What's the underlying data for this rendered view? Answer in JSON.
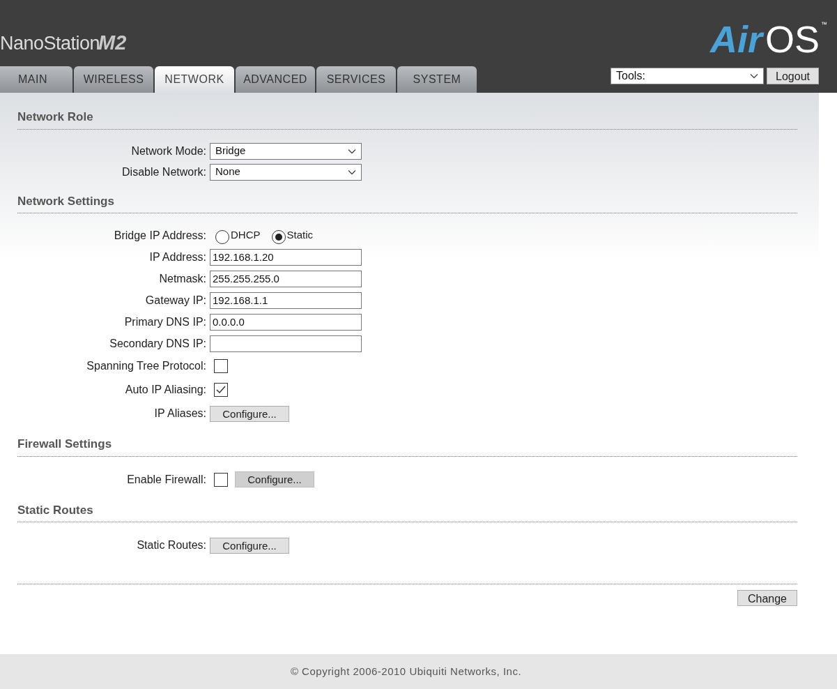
{
  "header": {
    "product": "NanoStation",
    "model": "M2",
    "logo": {
      "part_1": "Air",
      "part_2": "OS",
      "trademark": "™"
    }
  },
  "tabs": [
    {
      "label": "MAIN",
      "selected": false
    },
    {
      "label": "WIRELESS",
      "selected": false
    },
    {
      "label": "NETWORK",
      "selected": true
    },
    {
      "label": "ADVANCED",
      "selected": false
    },
    {
      "label": "SERVICES",
      "selected": false
    },
    {
      "label": "SYSTEM",
      "selected": false
    }
  ],
  "tools": {
    "value": "Tools:"
  },
  "logout_button": "Logout",
  "sections": [
    {
      "title": "Network Role",
      "rows": [
        {
          "kind": "select",
          "label": "Network Mode:",
          "value": "Bridge"
        },
        {
          "kind": "select",
          "label": "Disable Network:",
          "value": "None"
        }
      ]
    },
    {
      "title": "Network Settings",
      "rows": [
        {
          "kind": "radio",
          "label": "Bridge IP Address:",
          "options": [
            {
              "label": "DHCP",
              "selected": false
            },
            {
              "label": "Static",
              "selected": true
            }
          ]
        },
        {
          "kind": "text",
          "label": "IP Address:",
          "value": "192.168.1.20"
        },
        {
          "kind": "text",
          "label": "Netmask:",
          "value": "255.255.255.0"
        },
        {
          "kind": "text",
          "label": "Gateway IP:",
          "value": "192.168.1.1"
        },
        {
          "kind": "text",
          "label": "Primary DNS IP:",
          "value": "0.0.0.0"
        },
        {
          "kind": "text",
          "label": "Secondary DNS IP:"
        },
        {
          "kind": "checkbox",
          "label": "Spanning Tree Protocol:",
          "checked": false
        },
        {
          "kind": "checkbox",
          "label": "Auto IP Aliasing:",
          "checked": true
        },
        {
          "kind": "button",
          "label": "IP Aliases:",
          "button": "Configure...",
          "disabled": false
        }
      ]
    },
    {
      "title": "Firewall Settings",
      "rows": [
        {
          "kind": "checkbox_button",
          "label": "Enable Firewall:",
          "checked": false,
          "button": "Configure...",
          "disabled": true
        }
      ]
    },
    {
      "title": "Static Routes",
      "rows": [
        {
          "kind": "button",
          "label": "Static Routes:",
          "button": "Configure...",
          "disabled": false
        }
      ]
    }
  ],
  "change_button": "Change",
  "footer": "© Copyright 2006-2010 Ubiquiti Networks, Inc."
}
